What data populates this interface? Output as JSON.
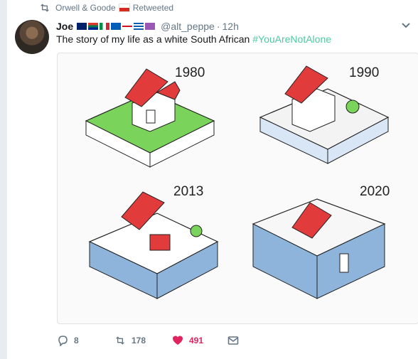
{
  "retweet": {
    "icon": "retweet-icon",
    "user": "Orwell & Goode",
    "label": "Retweeted"
  },
  "tweet": {
    "author_name": "Joe",
    "handle": "@alt_peppe",
    "separator": "·",
    "time": "12h",
    "text": "The story of my life as a white South African",
    "hashtag": "#YouAreNotAlone",
    "hashtag_color": "#4ec9a0"
  },
  "media": {
    "panels": [
      {
        "year": "1980"
      },
      {
        "year": "1990"
      },
      {
        "year": "2013"
      },
      {
        "year": "2020"
      }
    ]
  },
  "actions": {
    "reply_count": "8",
    "retweet_count": "178",
    "like_count": "491",
    "like_color": "#e0245e"
  }
}
